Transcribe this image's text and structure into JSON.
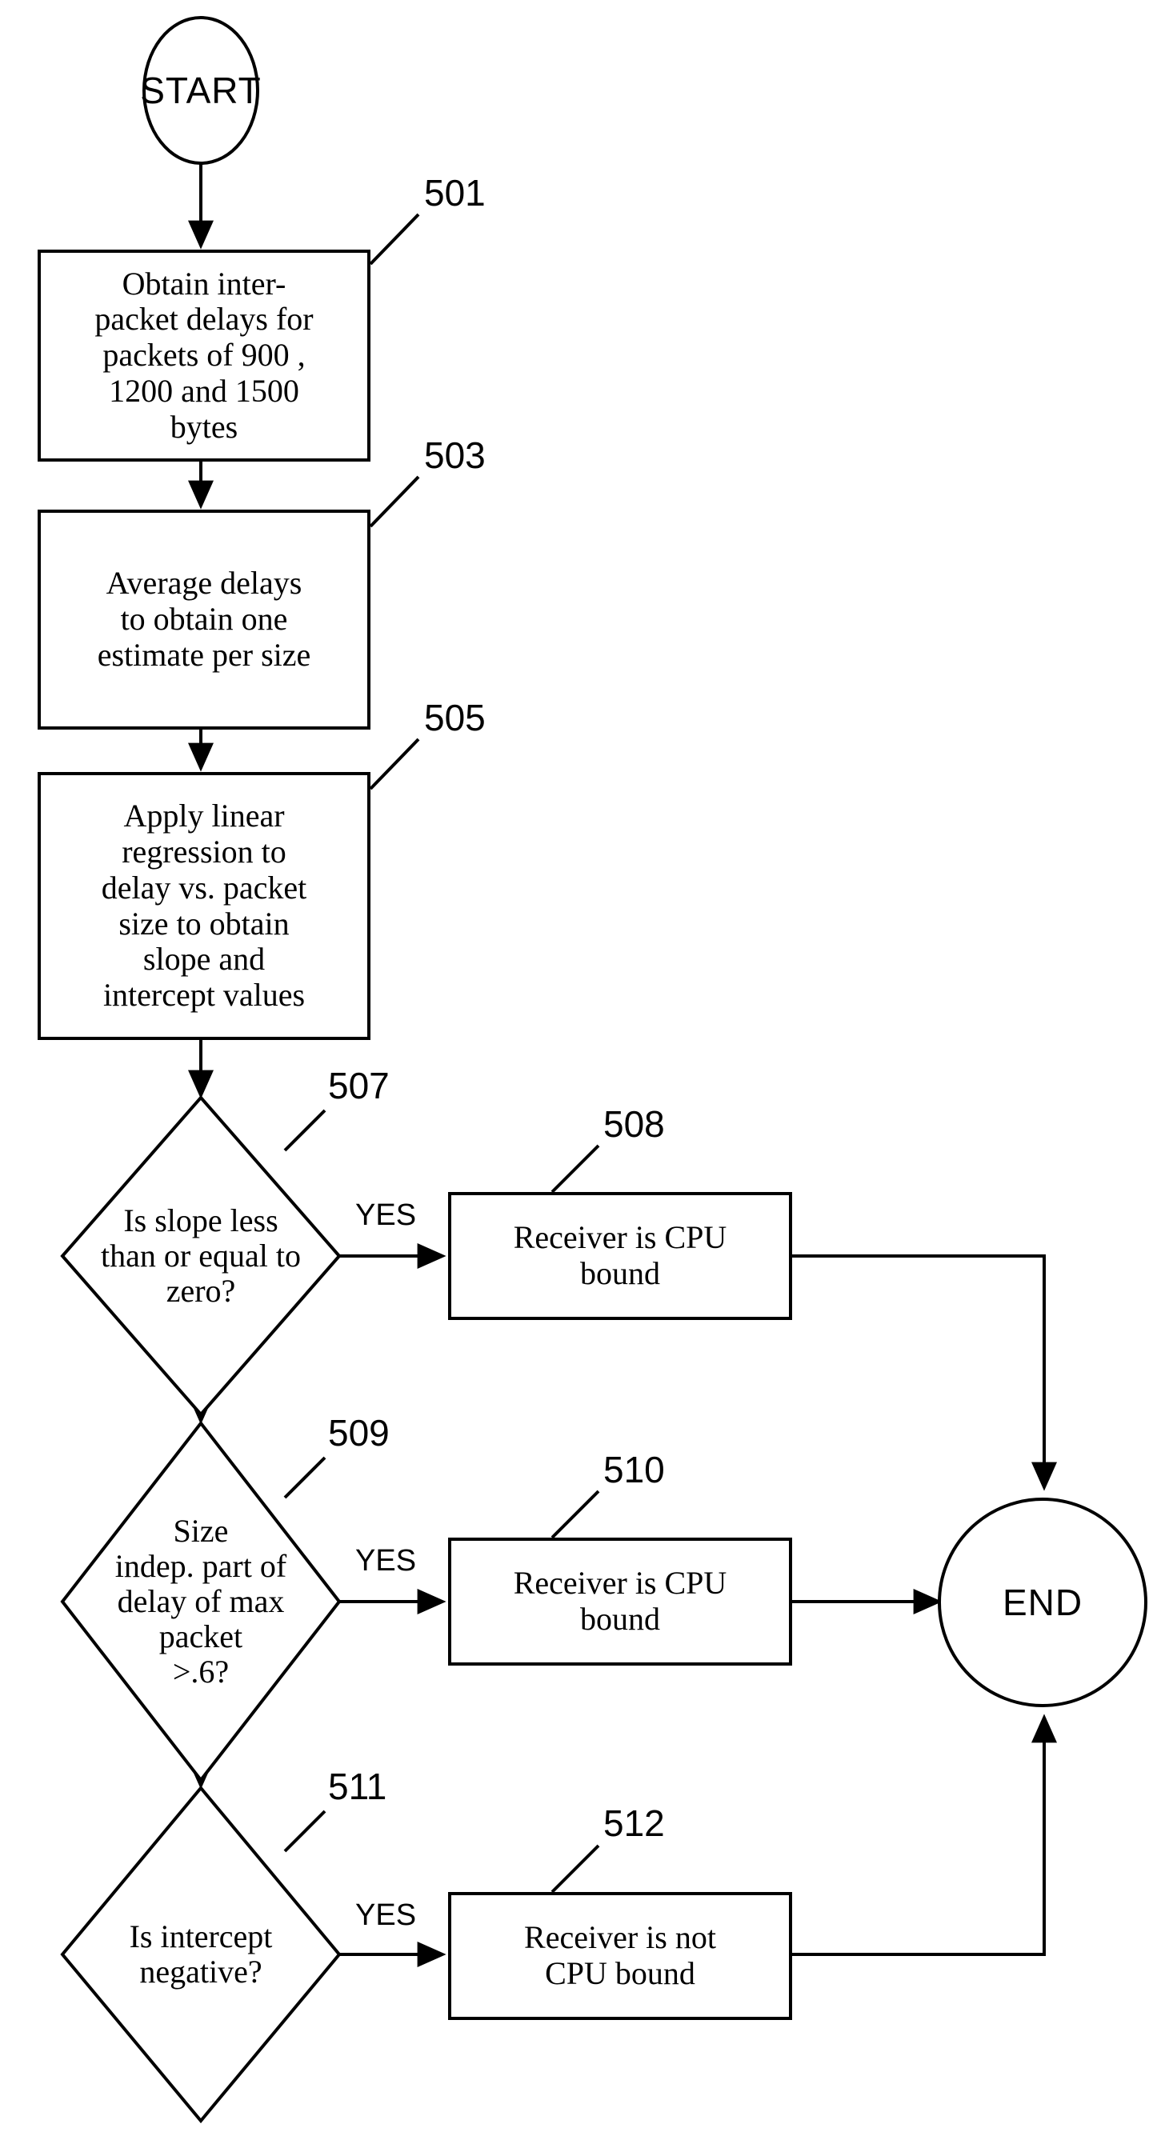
{
  "figure": {
    "type": "flowchart",
    "background_color": "#ffffff",
    "line_color": "#000000"
  },
  "nodes": {
    "start": {
      "label": "START"
    },
    "end": {
      "label": "END"
    },
    "step_501": {
      "ref": "501",
      "text": "Obtain inter-\npacket delays for\npackets of 900 ,\n1200 and 1500\nbytes"
    },
    "step_503": {
      "ref": "503",
      "text": "Average delays\nto obtain one\nestimate per size"
    },
    "step_505": {
      "ref": "505",
      "text": "Apply linear\nregression to\ndelay vs. packet\nsize to obtain\nslope and\nintercept values"
    },
    "decision_507": {
      "ref": "507",
      "text": "Is slope less\nthan or equal to\nzero?"
    },
    "result_508": {
      "ref": "508",
      "text": "Receiver is CPU\nbound"
    },
    "decision_509": {
      "ref": "509",
      "text": "Size\nindep. part of\ndelay of max\npacket\n>.6?"
    },
    "result_510": {
      "ref": "510",
      "text": "Receiver is CPU\nbound"
    },
    "decision_511": {
      "ref": "511",
      "text": "Is intercept\nnegative?"
    },
    "result_512": {
      "ref": "512",
      "text": "Receiver is not\nCPU bound"
    }
  },
  "edge_labels": {
    "yes_507": "YES",
    "yes_509": "YES",
    "yes_511": "YES"
  }
}
